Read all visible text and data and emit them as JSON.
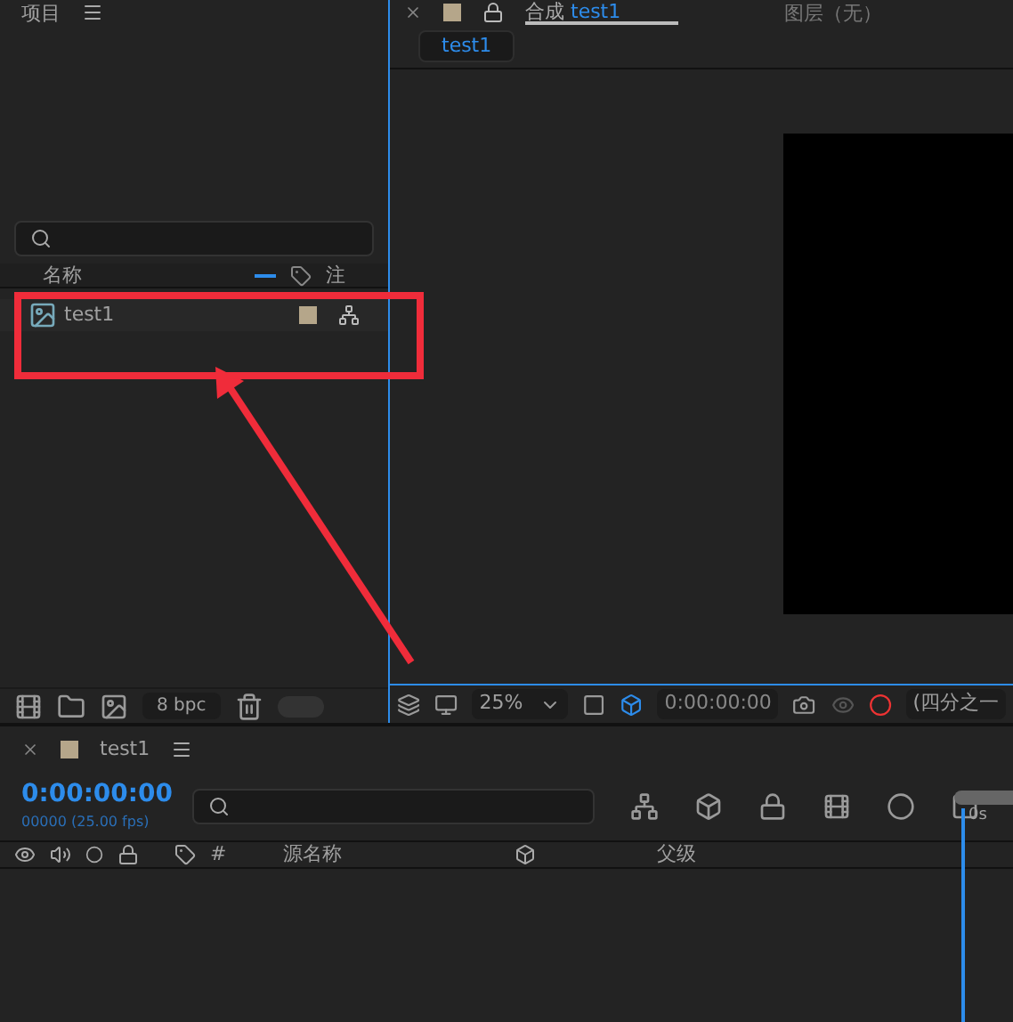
{
  "project_panel": {
    "title": "项目",
    "columns": [
      {
        "label": "名称"
      },
      {
        "label": "注"
      }
    ],
    "items": [
      {
        "name": "test1",
        "color": "#b5a68a"
      }
    ],
    "footer": {
      "bpc": "8 bpc",
      "toggle_on": false
    }
  },
  "viewer": {
    "tabs": [
      {
        "label": "合成",
        "name": "test1",
        "selected": true
      },
      {
        "label": "图层（无）",
        "selected": false
      }
    ],
    "comp_chip": "test1",
    "toolbar": {
      "zoom": "25%",
      "timecode": "0:00:00:00",
      "resolution": "(四分之一"
    }
  },
  "timeline": {
    "tab": "test1",
    "color": "#b5a68a",
    "timecode": "0:00:00:00",
    "fps": "00000 (25.00 fps)",
    "columns": [
      {
        "label": "#"
      },
      {
        "label": "源名称"
      },
      {
        "label": "父级"
      }
    ],
    "ruler_label": "0s"
  }
}
